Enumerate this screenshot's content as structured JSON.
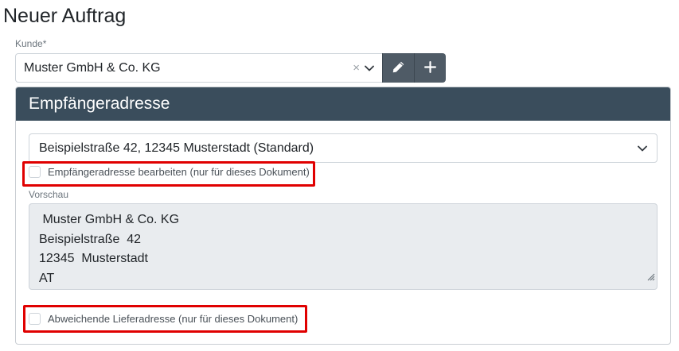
{
  "page": {
    "title": "Neuer Auftrag"
  },
  "customer": {
    "label": "Kunde*",
    "value": "Muster GmbH & Co. KG",
    "clear_symbol": "×",
    "icons": {
      "clear": "close-icon",
      "dropdown": "chevron-down-icon",
      "edit": "pencil-icon",
      "add": "plus-icon"
    }
  },
  "recipient_card": {
    "title": "Empfängeradresse",
    "address_select": {
      "value": "Beispielstraße 42, 12345 Musterstadt (Standard)"
    },
    "edit_checkbox": {
      "label": "Empfängeradresse bearbeiten (nur für dieses Dokument)",
      "checked": false
    },
    "preview": {
      "label": "Vorschau",
      "lines": [
        " Muster GmbH & Co. KG",
        "Beispielstraße  42",
        "12345  Musterstadt",
        "AT"
      ]
    },
    "delivery_checkbox": {
      "label": "Abweichende Lieferadresse (nur für dieses Dokument)",
      "checked": false
    }
  },
  "colors": {
    "header_bg": "#3a4d5c",
    "button_bg": "#4f5b66",
    "highlight": "#e00000",
    "preview_bg": "#e9ecef"
  }
}
